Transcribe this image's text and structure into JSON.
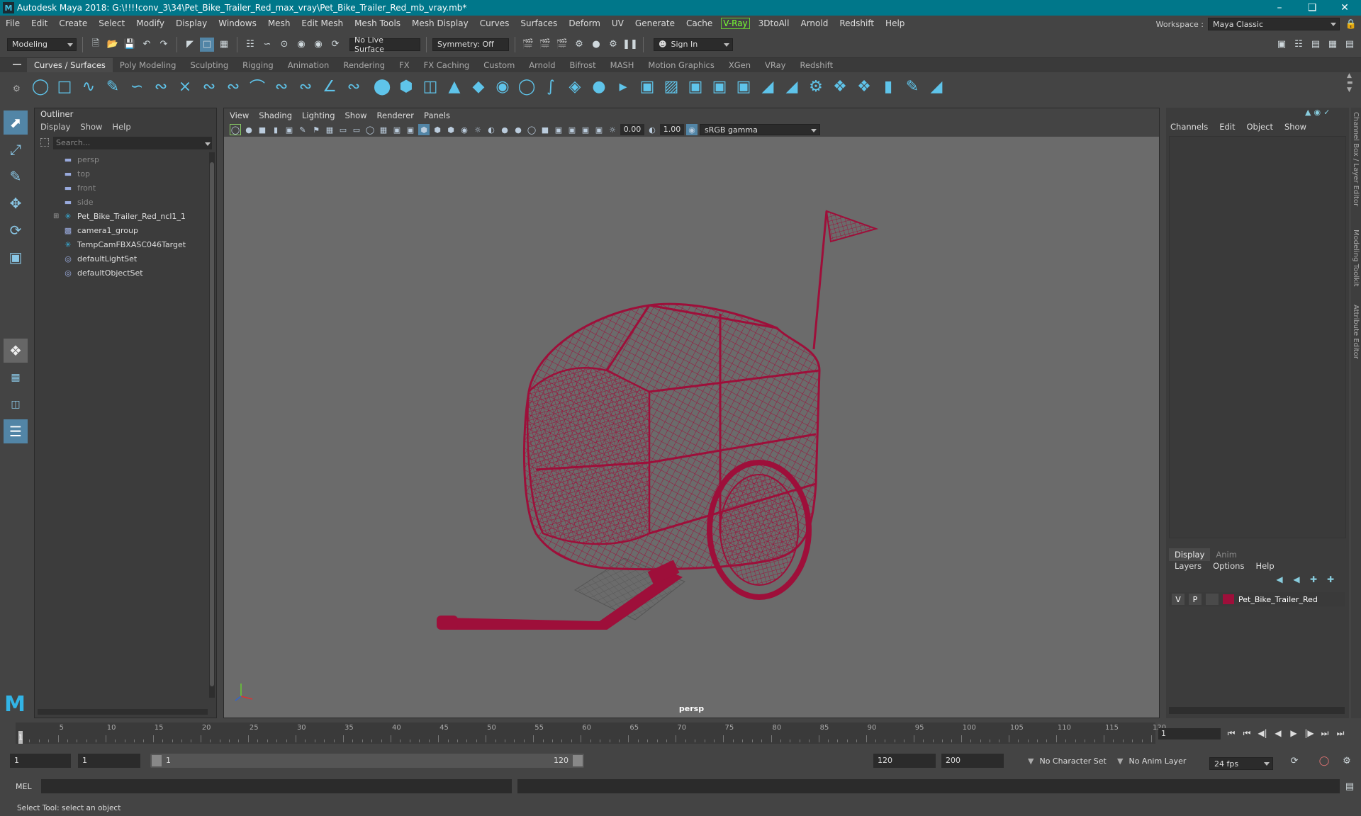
{
  "window": {
    "title": "Autodesk Maya 2018: G:\\!!!!conv_3\\34\\Pet_Bike_Trailer_Red_max_vray\\Pet_Bike_Trailer_Red_mb_vray.mb*"
  },
  "menubar": {
    "items": [
      "File",
      "Edit",
      "Create",
      "Select",
      "Modify",
      "Display",
      "Windows",
      "Mesh",
      "Edit Mesh",
      "Mesh Tools",
      "Mesh Display",
      "Curves",
      "Surfaces",
      "Deform",
      "UV",
      "Generate",
      "Cache"
    ],
    "vray": "V-Ray",
    "items2": [
      "3DtoAll",
      "Arnold",
      "Redshift",
      "Help"
    ],
    "workspace_label": "Workspace :",
    "workspace_value": "Maya Classic"
  },
  "statusline": {
    "mode": "Modeling",
    "live_surface": "No Live Surface",
    "symmetry": "Symmetry: Off",
    "sign_in": "Sign In"
  },
  "shelf": {
    "tabs": [
      "Curves / Surfaces",
      "Poly Modeling",
      "Sculpting",
      "Rigging",
      "Animation",
      "Rendering",
      "FX",
      "FX Caching",
      "Custom",
      "Arnold",
      "Bifrost",
      "MASH",
      "Motion Graphics",
      "XGen",
      "VRay",
      "Redshift"
    ],
    "active_tab": "Curves / Surfaces"
  },
  "outliner": {
    "tab": "Outliner",
    "menu": [
      "Display",
      "Show",
      "Help"
    ],
    "search_placeholder": "Search...",
    "items": [
      {
        "label": "persp",
        "icon": "camera-icon",
        "dim": true
      },
      {
        "label": "top",
        "icon": "camera-icon",
        "dim": true
      },
      {
        "label": "front",
        "icon": "camera-icon",
        "dim": true
      },
      {
        "label": "side",
        "icon": "camera-icon",
        "dim": true
      },
      {
        "label": "Pet_Bike_Trailer_Red_ncl1_1",
        "icon": "transform-icon",
        "dim": false,
        "expandable": true
      },
      {
        "label": "camera1_group",
        "icon": "group-icon",
        "dim": false
      },
      {
        "label": "TempCamFBXASC046Target",
        "icon": "transform-icon",
        "dim": false
      },
      {
        "label": "defaultLightSet",
        "icon": "set-icon",
        "dim": false
      },
      {
        "label": "defaultObjectSet",
        "icon": "set-icon",
        "dim": false
      }
    ]
  },
  "viewport": {
    "menu": [
      "View",
      "Shading",
      "Lighting",
      "Show",
      "Renderer",
      "Panels"
    ],
    "exposure": "0.00",
    "gamma": "1.00",
    "color_space": "sRGB gamma",
    "camera_label": "persp",
    "wire_color": "#9e0f3a"
  },
  "channelbox": {
    "menu": [
      "Channels",
      "Edit",
      "Object",
      "Show"
    ],
    "side_tabs": [
      "Channel Box / Layer Editor",
      "Modeling Toolkit",
      "Attribute Editor"
    ]
  },
  "layers": {
    "tabs": [
      "Display",
      "Anim"
    ],
    "menu": [
      "Layers",
      "Options",
      "Help"
    ],
    "row": {
      "v": "V",
      "p": "P",
      "name": "Pet_Bike_Trailer_Red",
      "color": "#9e0f3a"
    }
  },
  "timeline": {
    "ticks": [
      "5",
      "10",
      "15",
      "20",
      "25",
      "30",
      "35",
      "40",
      "45",
      "50",
      "55",
      "60",
      "65",
      "70",
      "75",
      "80",
      "85",
      "90",
      "95",
      "100",
      "105",
      "110",
      "115",
      "120"
    ],
    "current_frame": "1",
    "start_marker": "1"
  },
  "range": {
    "anim_start": "1",
    "playback_start": "1",
    "slider_start": "1",
    "slider_end": "120",
    "playback_end": "120",
    "anim_end": "200",
    "character_set": "No Character Set",
    "anim_layer": "No Anim Layer",
    "fps": "24 fps"
  },
  "command": {
    "label": "MEL"
  },
  "helpline": {
    "text": "Select Tool: select an object"
  }
}
